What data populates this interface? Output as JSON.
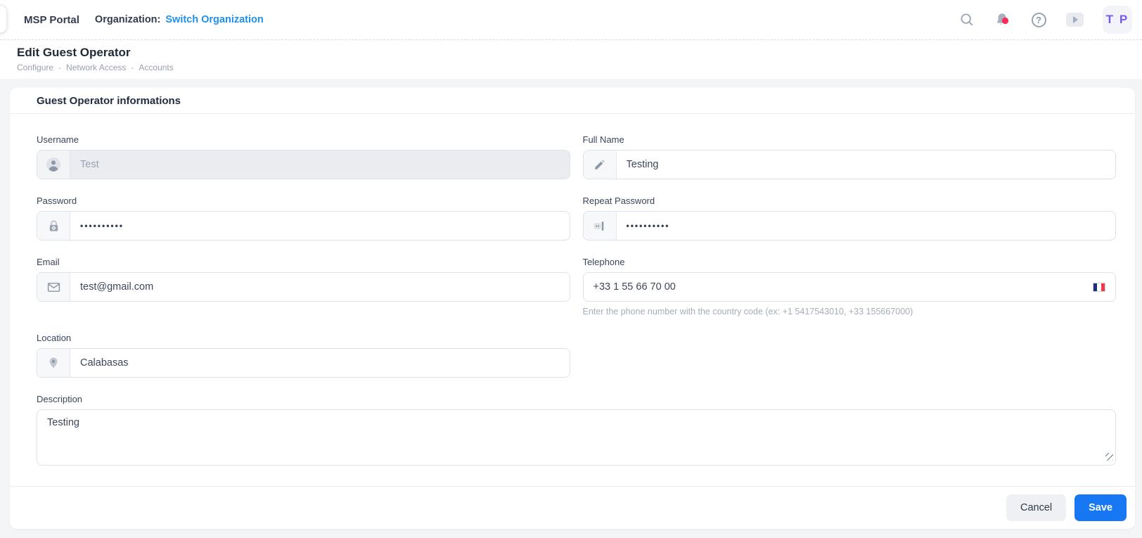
{
  "topbar": {
    "brand": "MSP Portal",
    "org_label": "Organization:",
    "org_link": "Switch Organization",
    "avatar_initials": "T P",
    "help_glyph": "?"
  },
  "header": {
    "title": "Edit Guest Operator",
    "breadcrumb": [
      "Configure",
      "Network Access",
      "Accounts"
    ],
    "breadcrumb_separator": "-"
  },
  "card": {
    "title": "Guest Operator informations",
    "fields": {
      "username": {
        "label": "Username",
        "value": "Test"
      },
      "full_name": {
        "label": "Full Name",
        "value": "Testing"
      },
      "password": {
        "label": "Password",
        "value": "••••••••••"
      },
      "repeat_password": {
        "label": "Repeat Password",
        "value": "••••••••••"
      },
      "email": {
        "label": "Email",
        "value": "test@gmail.com"
      },
      "telephone": {
        "label": "Telephone",
        "value": "+33 1 55 66 70 00",
        "helper": "Enter the phone number with the country code (ex: +1 5417543010, +33 155667000)",
        "flag": "france"
      },
      "location": {
        "label": "Location",
        "value": "Calabasas"
      },
      "description": {
        "label": "Description",
        "value": "Testing"
      }
    },
    "footer": {
      "cancel_label": "Cancel",
      "save_label": "Save"
    }
  },
  "colors": {
    "accent_blue": "#1877f2",
    "link_blue": "#2090ea",
    "avatar_purple": "#7857f7",
    "notification_red": "#fb2b57",
    "flag_blue": "#1b2f7e",
    "flag_white": "#ffffff",
    "flag_red": "#ee3a4c",
    "page_bg": "#f4f5f7"
  }
}
